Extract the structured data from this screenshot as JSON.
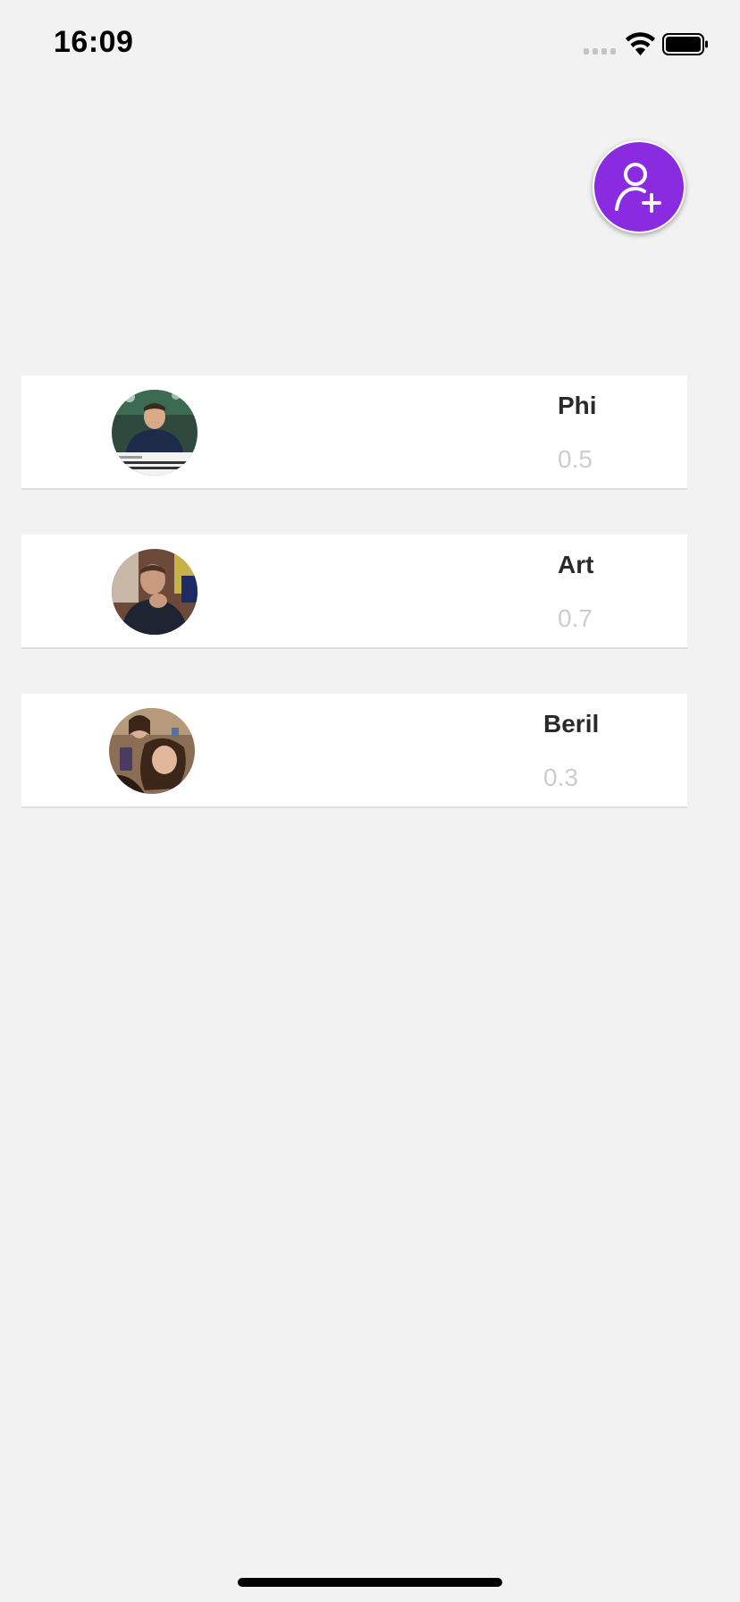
{
  "status_bar": {
    "time": "16:09",
    "icons": [
      "signal-icon",
      "wifi-icon",
      "battery-icon"
    ]
  },
  "add_button": {
    "icon": "add-user-icon",
    "color": "#8a2be2"
  },
  "people": [
    {
      "name": "Phi",
      "value": "0.5",
      "avatar": "avatar-photo-phi"
    },
    {
      "name": "Art",
      "value": "0.7",
      "avatar": "avatar-photo-art"
    },
    {
      "name": "Beril",
      "value": "0.3",
      "avatar": "avatar-photo-beril"
    }
  ]
}
